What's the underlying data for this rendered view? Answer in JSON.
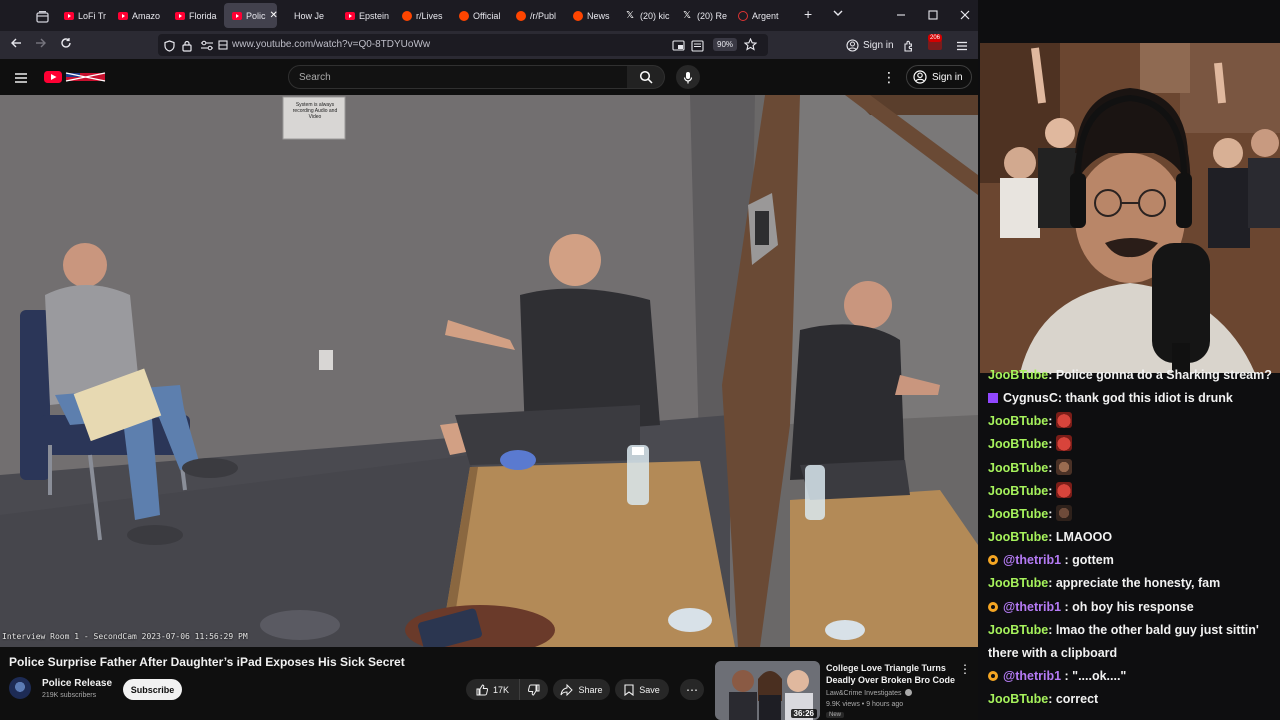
{
  "browser": {
    "tabs": [
      {
        "label": "LoFi Tr",
        "icon": "youtube-icon"
      },
      {
        "label": "Amazo",
        "icon": "youtube-icon"
      },
      {
        "label": "Florida",
        "icon": "youtube-icon"
      },
      {
        "label": "Polic",
        "icon": "youtube-icon",
        "active": true
      },
      {
        "label": "How Je",
        "icon": "none"
      },
      {
        "label": "Epstein",
        "icon": "youtube-icon"
      },
      {
        "label": "r/Lives",
        "icon": "reddit-icon"
      },
      {
        "label": "Official",
        "icon": "reddit-icon"
      },
      {
        "label": "/r/Publ",
        "icon": "reddit-icon"
      },
      {
        "label": "News",
        "icon": "reddit-icon"
      },
      {
        "label": "(20) kic",
        "icon": "x-icon"
      },
      {
        "label": "(20) Re",
        "icon": "x-icon"
      },
      {
        "label": "Argent",
        "icon": "globe-icon"
      }
    ],
    "url": "www.youtube.com/watch?v=Q0-8TDYUoWw",
    "zoom": "90%",
    "signin_label": "Sign in",
    "extension_badge": "206"
  },
  "youtube": {
    "search_placeholder": "Search",
    "signin_label": "Sign in",
    "video": {
      "title": "Police Surprise Father After Daughter’s iPad Exposes His Sick Secret",
      "overlay_caption": "Interview Room 1 - SecondCam 2023-07-06 11:56:29 PM",
      "sign_text": "System is always recording Audio and Video"
    },
    "channel": {
      "name": "Police Release",
      "subscribers": "219K subscribers",
      "subscribe_label": "Subscribe"
    },
    "actions": {
      "likes": "17K",
      "share_label": "Share",
      "save_label": "Save"
    },
    "recommended": {
      "title": "College Love Triangle Turns Deadly Over Broken Bro Code",
      "channel": "Law&Crime Investigates",
      "meta": "9.9K views • 9 hours ago",
      "badge": "New",
      "duration": "36:26"
    }
  },
  "chat": {
    "messages": [
      {
        "user": "JooBTube",
        "text": ": Police gonna do a Sharking stream?",
        "badge": "none",
        "color": "#a6f25c"
      },
      {
        "user": "CygnusC",
        "text": ": thank god this idiot is drunk",
        "badge": "prime",
        "color": "#f2f2f2"
      },
      {
        "user": "JooBTube",
        "text": ": ",
        "badge": "none",
        "emote": "red",
        "color": "#a6f25c"
      },
      {
        "user": "JooBTube",
        "text": ": ",
        "badge": "none",
        "emote": "red",
        "color": "#a6f25c"
      },
      {
        "user": "JooBTube",
        "text": ": ",
        "badge": "none",
        "emote": "brown",
        "color": "#a6f25c"
      },
      {
        "user": "JooBTube",
        "text": ": ",
        "badge": "none",
        "emote": "red",
        "color": "#a6f25c"
      },
      {
        "user": "JooBTube",
        "text": ": ",
        "badge": "none",
        "emote": "dark",
        "color": "#a6f25c"
      },
      {
        "user": "JooBTube",
        "text": ": LMAOOO",
        "badge": "none",
        "color": "#a6f25c"
      },
      {
        "user": "@thetrib1",
        "text": " : gottem",
        "badge": "sub",
        "color": "#b57bf5"
      },
      {
        "user": "JooBTube",
        "text": ": appreciate the honesty, fam",
        "badge": "none",
        "color": "#a6f25c"
      },
      {
        "user": "@thetrib1",
        "text": " : oh boy his response",
        "badge": "sub",
        "color": "#b57bf5"
      },
      {
        "user": "JooBTube",
        "text": ": lmao the other bald guy just sittin'",
        "badge": "none",
        "color": "#a6f25c"
      },
      {
        "user": "",
        "text": "there with a clipboard",
        "badge": "none",
        "color": "#f2f2f2"
      },
      {
        "user": "@thetrib1",
        "text": " : \"....ok....\"",
        "badge": "sub",
        "color": "#b57bf5"
      },
      {
        "user": "JooBTube",
        "text": ": correct",
        "badge": "none",
        "color": "#a6f25c"
      }
    ]
  }
}
